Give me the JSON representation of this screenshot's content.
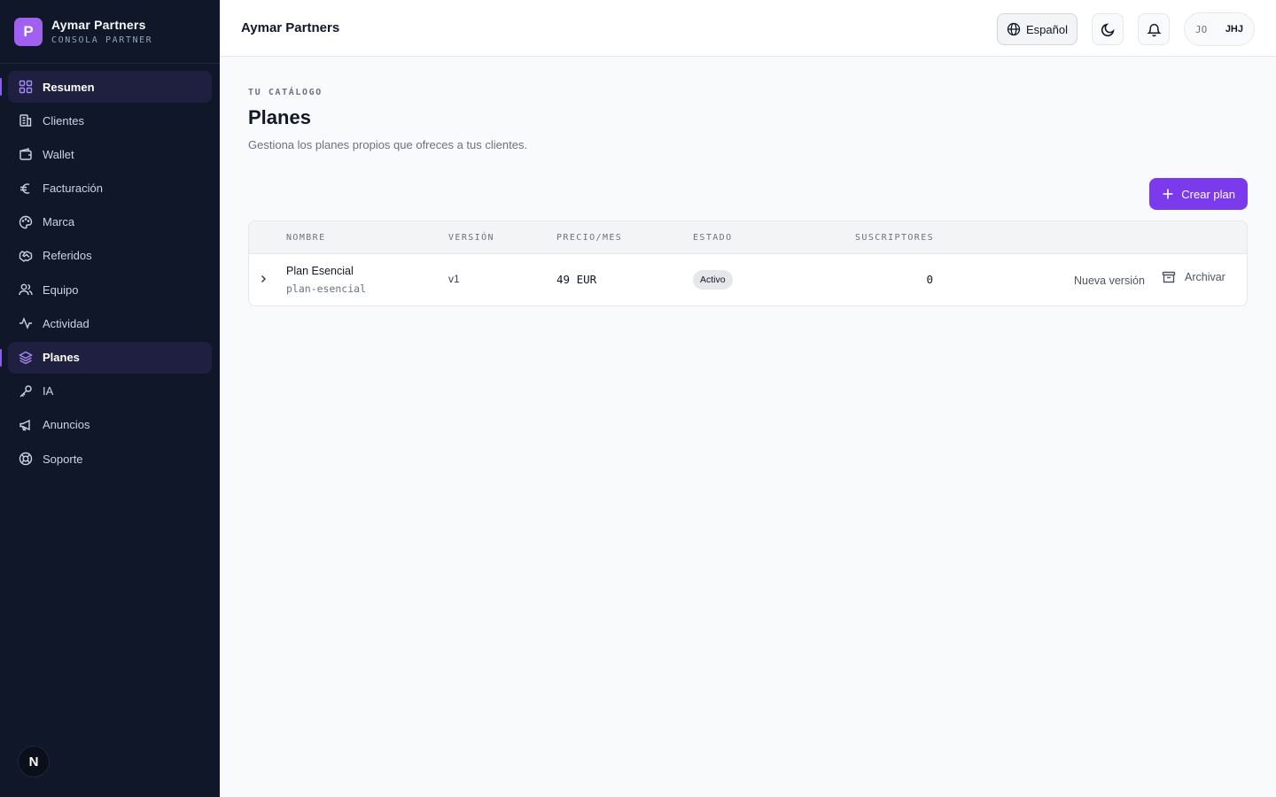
{
  "brand": {
    "logo_letter": "P",
    "name": "Aymar Partners",
    "subtitle": "CONSOLA PARTNER"
  },
  "sidebar": {
    "items": [
      {
        "label": "Resumen",
        "icon": "grid-icon",
        "active": true
      },
      {
        "label": "Clientes",
        "icon": "building-icon",
        "active": false
      },
      {
        "label": "Wallet",
        "icon": "wallet-icon",
        "active": false
      },
      {
        "label": "Facturación",
        "icon": "euro-icon",
        "active": false
      },
      {
        "label": "Marca",
        "icon": "palette-icon",
        "active": false
      },
      {
        "label": "Referidos",
        "icon": "handshake-icon",
        "active": false
      },
      {
        "label": "Equipo",
        "icon": "users-icon",
        "active": false
      },
      {
        "label": "Actividad",
        "icon": "activity-icon",
        "active": false
      },
      {
        "label": "Planes",
        "icon": "layers-icon",
        "active": true
      },
      {
        "label": "IA",
        "icon": "key-icon",
        "active": false
      },
      {
        "label": "Anuncios",
        "icon": "megaphone-icon",
        "active": false
      },
      {
        "label": "Soporte",
        "icon": "lifebuoy-icon",
        "active": false
      }
    ],
    "bottom_badge": "N"
  },
  "topbar": {
    "title": "Aymar Partners",
    "language": "Español",
    "user_initials": "JO",
    "user_name": "JHJ"
  },
  "main": {
    "eyebrow": "TU CATÁLOGO",
    "title": "Planes",
    "description": "Gestiona los planes propios que ofreces a tus clientes.",
    "create_label": "Crear plan"
  },
  "table": {
    "headers": {
      "name": "NOMBRE",
      "version": "VERSIÓN",
      "price": "PRECIO/MES",
      "status": "ESTADO",
      "subscribers": "SUSCRIPTORES"
    },
    "rows": [
      {
        "name": "Plan Esencial",
        "slug": "plan-esencial",
        "version": "v1",
        "price": "49 EUR",
        "status": "Activo",
        "subscribers": "0",
        "new_version_label": "Nueva versión",
        "archive_label": "Archivar"
      }
    ]
  },
  "colors": {
    "sidebar_bg": "#0f1729",
    "accent": "#7c3aed",
    "logo": "#a061f0"
  }
}
